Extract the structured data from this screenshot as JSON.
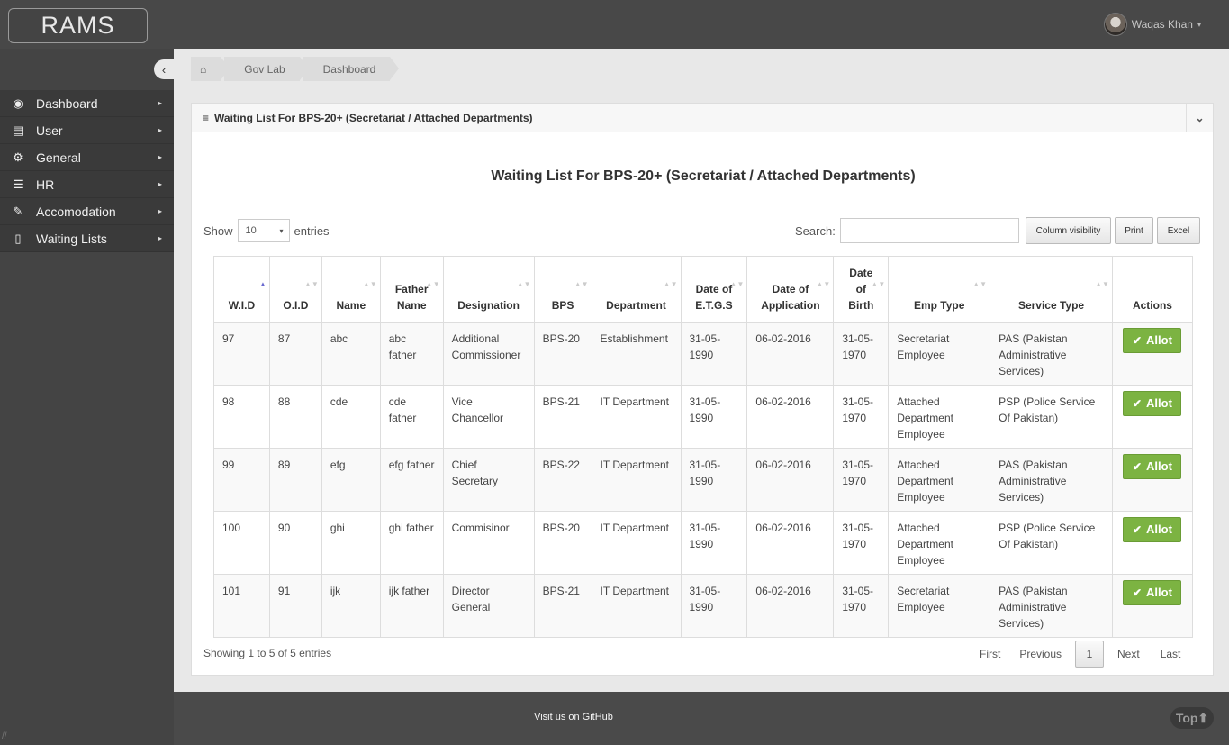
{
  "app": {
    "brand": "RAMS"
  },
  "user": {
    "name": "Waqas Khan",
    "caret": "▾"
  },
  "sidebar": {
    "collapse_icon": "‹",
    "arrow": "▸",
    "items": [
      {
        "label": "Dashboard",
        "icon": "dashboard-icon",
        "glyph": "◉"
      },
      {
        "label": "User",
        "icon": "book-icon",
        "glyph": "▤"
      },
      {
        "label": "General",
        "icon": "gears-icon",
        "glyph": "⚙"
      },
      {
        "label": "HR",
        "icon": "server-icon",
        "glyph": "☰"
      },
      {
        "label": "Accomodation",
        "icon": "pen-icon",
        "glyph": "✎"
      },
      {
        "label": "Waiting Lists",
        "icon": "document-icon",
        "glyph": "▯"
      }
    ]
  },
  "breadcrumb": {
    "home_glyph": "⌂",
    "items": [
      "Gov Lab",
      "Dashboard"
    ]
  },
  "box": {
    "header": "Waiting List For BPS-20+ (Secretariat / Attached Departments)",
    "menu_glyph": "≡",
    "toggle_glyph": "⌄",
    "title": "Waiting List For BPS-20+ (Secretariat / Attached Departments)"
  },
  "controls": {
    "show": "Show",
    "length_value": "10",
    "length_caret": "▾",
    "entries": "entries",
    "search_label": "Search:",
    "search_value": "",
    "buttons": [
      "Column visibility",
      "Print",
      "Excel"
    ]
  },
  "table": {
    "columns": [
      [
        "W.I.D"
      ],
      [
        "O.I.D"
      ],
      [
        "Name"
      ],
      [
        "Father",
        "Name"
      ],
      [
        "Designation"
      ],
      [
        "BPS"
      ],
      [
        "Department"
      ],
      [
        "Date of",
        "E.T.G.S"
      ],
      [
        "Date of",
        "Application"
      ],
      [
        "Date",
        "of",
        "Birth"
      ],
      [
        "Emp Type"
      ],
      [
        "Service Type"
      ],
      [
        "Actions"
      ]
    ],
    "sort_glyph": "▲▼",
    "sort_active_glyph": "▲",
    "action_label": "Allot",
    "action_glyph": "✔",
    "rows": [
      [
        "97",
        "87",
        "abc",
        "abc father",
        "Additional Commissioner",
        "BPS-20",
        "Establishment",
        "31-05-1990",
        "06-02-2016",
        "31-05-1970",
        "Secretariat Employee",
        "PAS (Pakistan Administrative Services)"
      ],
      [
        "98",
        "88",
        "cde",
        "cde father",
        "Vice Chancellor",
        "BPS-21",
        "IT Department",
        "31-05-1990",
        "06-02-2016",
        "31-05-1970",
        "Attached Department Employee",
        "PSP (Police Service Of Pakistan)"
      ],
      [
        "99",
        "89",
        "efg",
        "efg father",
        "Chief Secretary",
        "BPS-22",
        "IT Department",
        "31-05-1990",
        "06-02-2016",
        "31-05-1970",
        "Attached Department Employee",
        "PAS (Pakistan Administrative Services)"
      ],
      [
        "100",
        "90",
        "ghi",
        "ghi father",
        "Commisinor",
        "BPS-20",
        "IT Department",
        "31-05-1990",
        "06-02-2016",
        "31-05-1970",
        "Attached Department Employee",
        "PSP (Police Service Of Pakistan)"
      ],
      [
        "101",
        "91",
        "ijk",
        "ijk father",
        "Director General",
        "BPS-21",
        "IT Department",
        "31-05-1990",
        "06-02-2016",
        "31-05-1970",
        "Secretariat Employee",
        "PAS (Pakistan Administrative Services)"
      ]
    ]
  },
  "pagination": {
    "info": "Showing 1 to 5 of 5 entries",
    "first": "First",
    "previous": "Previous",
    "current": "1",
    "next": "Next",
    "last": "Last"
  },
  "footer": {
    "link": "Visit us on GitHub",
    "top_label": "Top",
    "top_glyph": "⬆"
  }
}
